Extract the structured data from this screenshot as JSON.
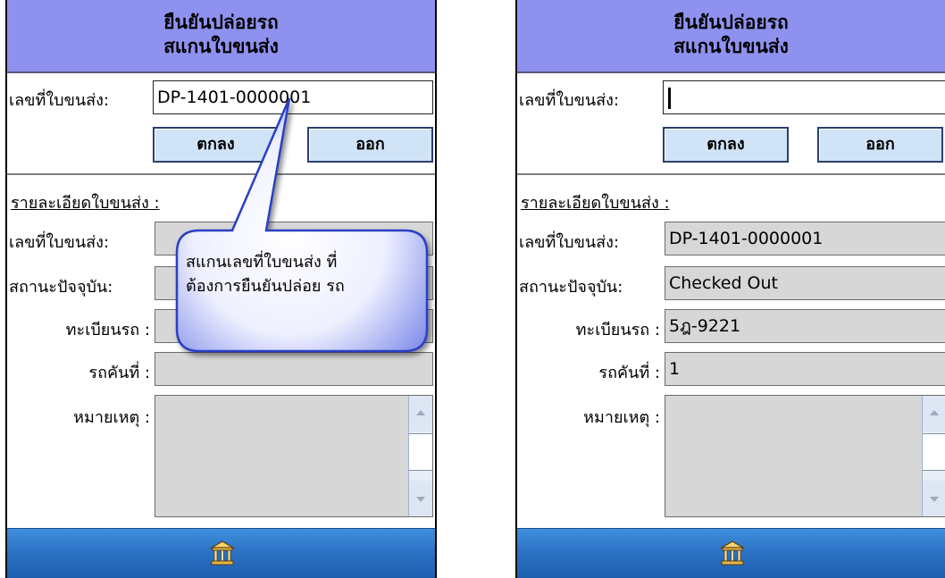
{
  "title": {
    "line1": "ยืนยันปล่อยรถ",
    "line2": "สแกนใบขนส่ง"
  },
  "form": {
    "doc_label": "เลขที่ใบขนส่ง:",
    "ok_button": "ตกลง",
    "exit_button": "ออก",
    "section_header": "รายละเอียดใบขนส่ง :",
    "detail_doc_label": "เลขที่ใบขนส่ง:",
    "status_label": "สถานะปัจจุบัน:",
    "plate_label": "ทะเบียนรถ :",
    "vehicle_no_label": "รถคันที่ :",
    "remark_label": "หมายเหตุ :"
  },
  "left_screen": {
    "doc_input_value": "DP-1401-0000001",
    "detail_doc_value": "",
    "status_value": "",
    "plate_value": "",
    "vehicle_no_value": "",
    "remark_value": "",
    "callout_text": "สแกนเลขที่ใบขนส่ง ที่ต้องการยืนยันปล่อย รถ"
  },
  "right_screen": {
    "doc_input_value": "",
    "detail_doc_value": "DP-1401-0000001",
    "status_value": "Checked Out",
    "plate_value": "5ฎ-9221",
    "vehicle_no_value": "1",
    "remark_value": ""
  },
  "icons": {
    "bottom_bar": "home-icon",
    "scroll_up": "scroll-up-arrow-icon",
    "scroll_down": "scroll-down-arrow-icon"
  },
  "colors": {
    "title_bar": "#8f91ef",
    "button": "#d1e4f7",
    "readonly_field": "#d7d7d7",
    "bottom_bar": "#2d73c6",
    "callout": "#3b5bdb"
  }
}
